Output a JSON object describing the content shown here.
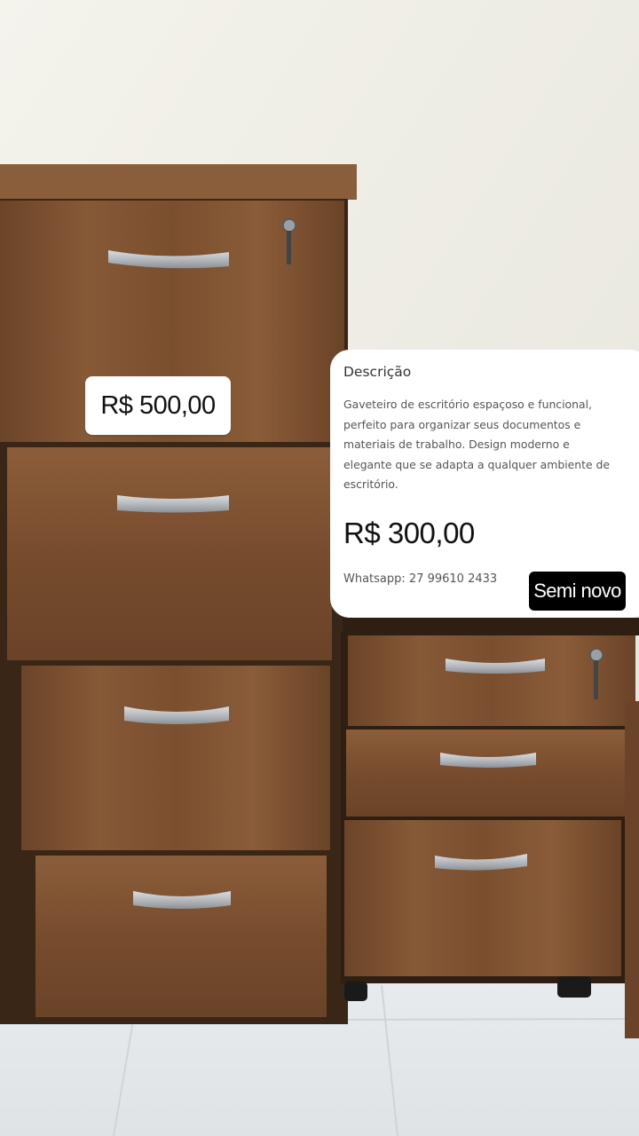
{
  "photo": {
    "subject": "office-filing-cabinets",
    "colors": {
      "wall": "#ecebe3",
      "floor": "#e4e8ec",
      "wood": "#7a4f2f",
      "handle": "#b9bdc1"
    }
  },
  "price_tag": {
    "price": "R$ 500,00"
  },
  "description_card": {
    "title": "Descrição",
    "body": "Gaveteiro de escritório espaçoso e funcional, perfeito para organizar seus documentos e materiais de trabalho. Design moderno e elegante que se adapta a qualquer ambiente de escritório.",
    "price": "R$ 300,00",
    "contact": "Whatsapp: 27 99610 2433",
    "condition_badge": "Semi novo"
  }
}
